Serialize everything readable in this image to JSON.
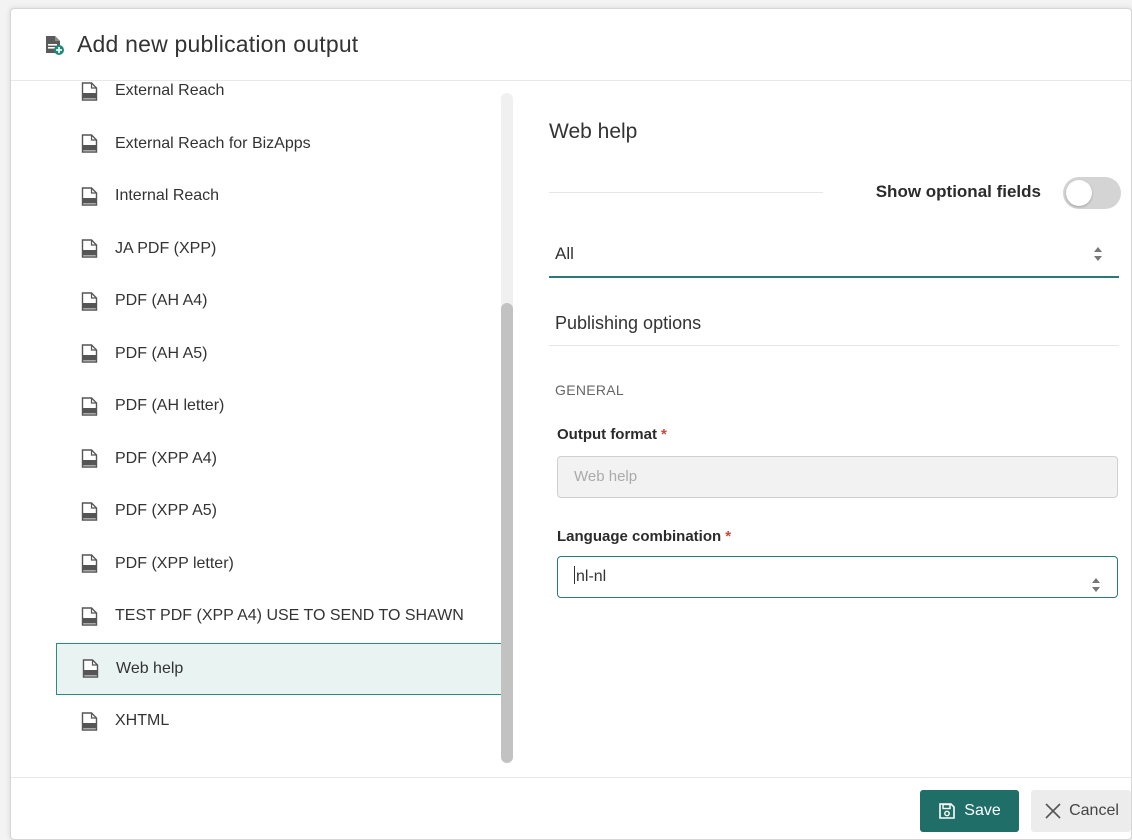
{
  "dialog": {
    "title": "Add new publication output",
    "header_icon": "document-add-icon"
  },
  "output_list": {
    "items": [
      {
        "label": "External Reach",
        "icon": "document-icon",
        "selected": false
      },
      {
        "label": "External Reach for BizApps",
        "icon": "document-icon",
        "selected": false
      },
      {
        "label": "Internal Reach",
        "icon": "document-icon",
        "selected": false
      },
      {
        "label": "JA PDF (XPP)",
        "icon": "document-icon",
        "selected": false
      },
      {
        "label": "PDF (AH A4)",
        "icon": "document-icon",
        "selected": false
      },
      {
        "label": "PDF (AH A5)",
        "icon": "document-icon",
        "selected": false
      },
      {
        "label": "PDF (AH letter)",
        "icon": "document-icon",
        "selected": false
      },
      {
        "label": "PDF (XPP A4)",
        "icon": "document-icon",
        "selected": false
      },
      {
        "label": "PDF (XPP A5)",
        "icon": "document-icon",
        "selected": false
      },
      {
        "label": "PDF (XPP letter)",
        "icon": "document-icon",
        "selected": false
      },
      {
        "label": "TEST PDF (XPP A4) USE TO SEND TO SHAWN",
        "icon": "document-icon",
        "selected": false
      },
      {
        "label": "Web help",
        "icon": "document-icon",
        "selected": true
      },
      {
        "label": "XHTML",
        "icon": "document-icon",
        "selected": false
      }
    ]
  },
  "form": {
    "title": "Web help",
    "show_optional_label": "Show optional fields",
    "show_optional_on": false,
    "filter_value": "All",
    "section_title": "Publishing options",
    "group_label": "GENERAL",
    "output_format": {
      "label": "Output format",
      "required_mark": "*",
      "value": "Web help"
    },
    "language_combination": {
      "label": "Language combination",
      "required_mark": "*",
      "value": "nl-nl"
    }
  },
  "footer": {
    "save_label": "Save",
    "cancel_label": "Cancel"
  },
  "colors": {
    "accent": "#1f6e68",
    "selected_bg": "#e9f3f2",
    "required": "#c4493a"
  }
}
